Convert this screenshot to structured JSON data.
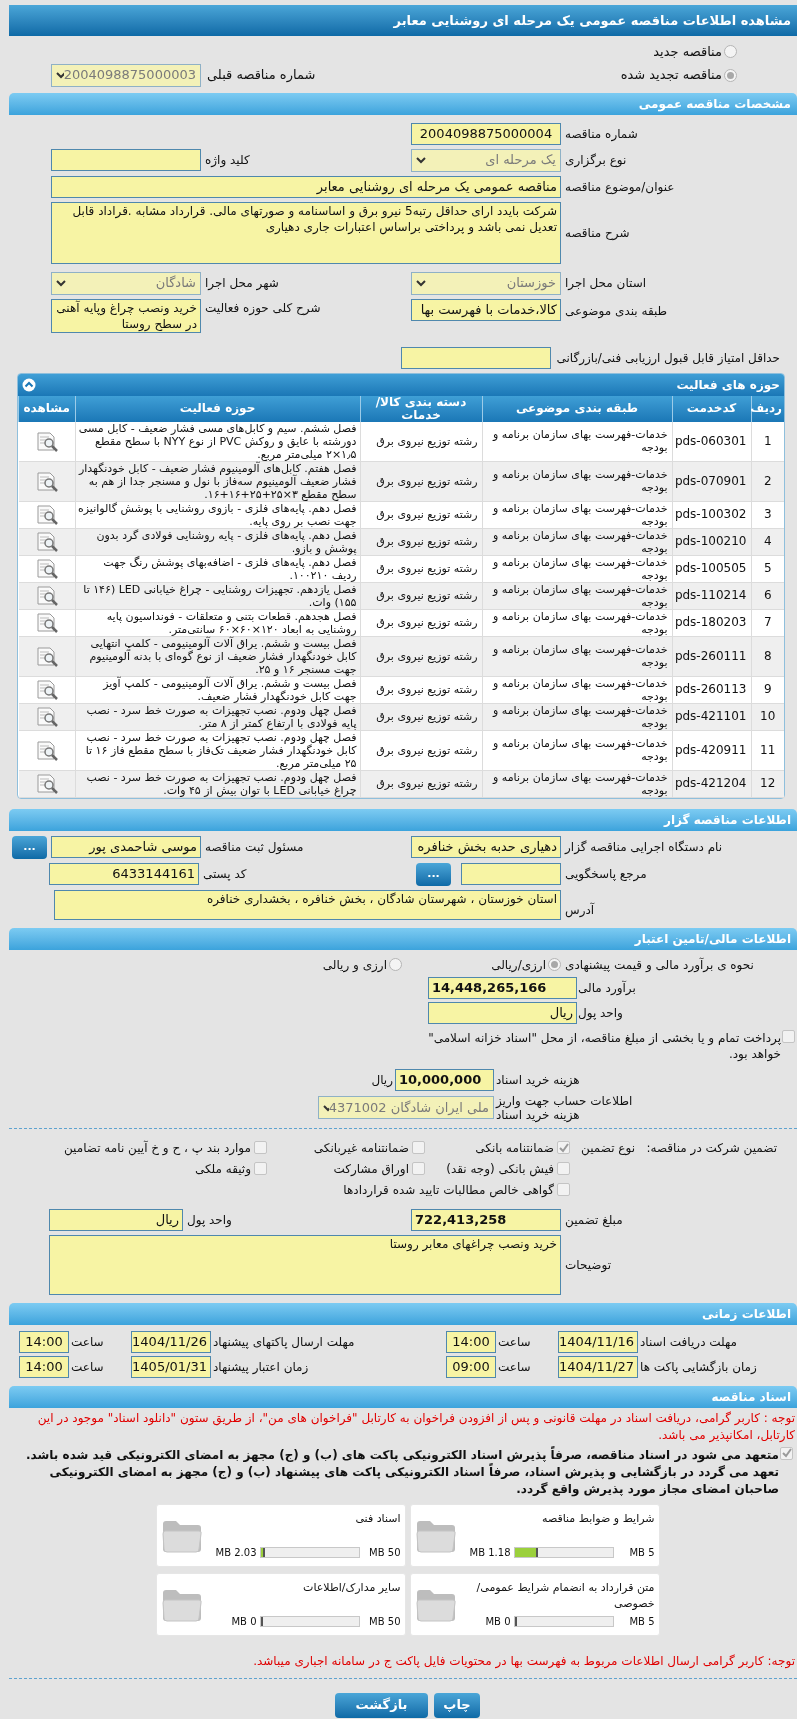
{
  "page_title": "مشاهده اطلاعات مناقصه عمومی یک مرحله ای روشنایی معابر",
  "tender_mode": [
    {
      "label": "مناقصه جدید",
      "selected": false
    },
    {
      "label": "مناقصه تجدید شده",
      "selected": true
    }
  ],
  "previous_tender": {
    "label": "شماره مناقصه قبلی",
    "value": "2004098875000003"
  },
  "general": {
    "title": "مشخصات مناقصه عمومی",
    "tender_number": {
      "label": "شماره مناقصه",
      "value": "2004098875000004"
    },
    "holding_type": {
      "label": "نوع برگزاری",
      "value": "یک مرحله ای"
    },
    "keyword": {
      "label": "کلید واژه"
    },
    "subject": {
      "label": "عنوان/موضوع مناقصه",
      "value": "مناقصه عمومی یک مرحله ای روشنایی معابر"
    },
    "description": {
      "label": "شرح مناقصه",
      "value": "شرکت بایدد ارای حداقل رتبه5 نیرو برق و اساسنامه و صورتهای مالی. قرارداد مشابه .قراداد قابل تعدیل نمی باشد و پرداختی براساس اعتبارات جاری دهیاری"
    },
    "province": {
      "label": "استان محل اجرا",
      "value": "خوزستان"
    },
    "city": {
      "label": "شهر محل اجرا",
      "value": "شادگان"
    },
    "category": {
      "label": "طبقه بندی موضوعی",
      "value": "کالا،خدمات با فهرست بها"
    },
    "activity_scope": {
      "label": "شرح کلی حوزه فعالیت",
      "value": "خرید ونصب چراغ وپایه آهنی در سطح روستا"
    },
    "min_score": {
      "label": "حداقل امتیاز قابل قبول ارزیابی فنی/بازرگانی"
    }
  },
  "activities": {
    "title": "حوزه های فعالیت",
    "columns": [
      "ردیف",
      "کدخدمت",
      "طبقه بندی موضوعی",
      "دسته بندی کالا/خدمات",
      "حوزه فعالیت",
      "مشاهده"
    ],
    "rows": [
      {
        "index": "1",
        "code": "pds-060301",
        "category": "خدمات-فهرست بهای سازمان برنامه و بودجه",
        "group": "رشته توزیع نیروی برق",
        "scope": "فصل ششم. سیم و کابل‌های مسی فشار ضعیف - کابل مسی دورشته با عایق و روکش PVC از نوع NYY با سطح مقطع ۱٫۵×۲ میلی‌متر مربع."
      },
      {
        "index": "2",
        "code": "pds-070901",
        "category": "خدمات-فهرست بهای سازمان برنامه و بودجه",
        "group": "رشته توزیع نیروی برق",
        "scope": "فصل هفتم. کابل‌های آلومینیوم فشار ضعیف - کابل خودنگهدار فشار ضعیف آلومینیوم سه‌فاز با نول و مسنجر جدا از هم به سطح مقطع ۳×۲۵+۲۵+۱۶+۱۶."
      },
      {
        "index": "3",
        "code": "pds-100302",
        "category": "خدمات-فهرست بهای سازمان برنامه و بودجه",
        "group": "رشته توزیع نیروی برق",
        "scope": "فصل دهم. پایه‌های فلزی - بازوی روشنایی با پوشش گالوانیزه جهت نصب بر روی پایه."
      },
      {
        "index": "4",
        "code": "pds-100210",
        "category": "خدمات-فهرست بهای سازمان برنامه و بودجه",
        "group": "رشته توزیع نیروی برق",
        "scope": "فصل دهم. پایه‌های فلزی - پایه روشنایی فولادی گرد بدون پوشش و بازو."
      },
      {
        "index": "5",
        "code": "pds-100505",
        "category": "خدمات-فهرست بهای سازمان برنامه و بودجه",
        "group": "رشته توزیع نیروی برق",
        "scope": "فصل دهم. پایه‌های فلزی - اضافه‌بهای پوشش رنگ جهت ردیف ۱۰۰۲۱۰."
      },
      {
        "index": "6",
        "code": "pds-110214",
        "category": "خدمات-فهرست بهای سازمان برنامه و بودجه",
        "group": "رشته توزیع نیروی برق",
        "scope": "فصل یازدهم. تجهیزات روشنایی - چراغ خیابانی LED (۱۴۶ تا ۱۵۵) وات."
      },
      {
        "index": "7",
        "code": "pds-180203",
        "category": "خدمات-فهرست بهای سازمان برنامه و بودجه",
        "group": "رشته توزیع نیروی برق",
        "scope": "فصل هجدهم. قطعات بتنی و متعلقات - فونداسیون پایه روشنایی به ابعاد ۱۲۰×۶۰×۶۰ سانتی‌متر."
      },
      {
        "index": "8",
        "code": "pds-260111",
        "category": "خدمات-فهرست بهای سازمان برنامه و بودجه",
        "group": "رشته توزیع نیروی برق",
        "scope": "فصل بیست و ششم. یراق آلات آلومینیومی - کلمپ انتهایی کابل خودنگهدار فشار ضعیف از نوع گوه‌ای با بدنه آلومینیوم جهت مسنجر ۱۶ و ۲۵."
      },
      {
        "index": "9",
        "code": "pds-260113",
        "category": "خدمات-فهرست بهای سازمان برنامه و بودجه",
        "group": "رشته توزیع نیروی برق",
        "scope": "فصل بیست و ششم. یراق آلات آلومینیومی - کلمپ آویز جهت کابل خودنگهدار فشار ضعیف."
      },
      {
        "index": "10",
        "code": "pds-421101",
        "category": "خدمات-فهرست بهای سازمان برنامه و بودجه",
        "group": "رشته توزیع نیروی برق",
        "scope": "فصل چهل ودوم. نصب تجهیزات به صورت خط سرد - نصب پایه فولادی با ارتفاع کمتر از ۸ متر."
      },
      {
        "index": "11",
        "code": "pds-420911",
        "category": "خدمات-فهرست بهای سازمان برنامه و بودجه",
        "group": "رشته توزیع نیروی برق",
        "scope": "فصل چهل ودوم. نصب تجهیزات به صورت خط سرد - نصب کابل خودنگهدار فشار ضعیف تک‌فاز با سطح مقطع فاز ۱۶ تا ۲۵ میلی‌متر مربع."
      },
      {
        "index": "12",
        "code": "pds-421204",
        "category": "خدمات-فهرست بهای سازمان برنامه و بودجه",
        "group": "رشته توزیع نیروی برق",
        "scope": "فصل چهل ودوم. نصب تجهیزات به صورت خط سرد - نصب چراغ خیابانی LED با توان بیش از ۴۵ وات."
      }
    ]
  },
  "organizer": {
    "title": "اطلاعات مناقصه گزار",
    "org_name": {
      "label": "نام دستگاه اجرایی مناقصه گزار",
      "value": "دهیاری حدبه بخش خنافره"
    },
    "registrar": {
      "label": "مسئول ثبت مناقصه",
      "value": "موسی شاحمدی پور",
      "button": "..."
    },
    "reference": {
      "label": "مرجع پاسخگویی",
      "button": "..."
    },
    "postal_code": {
      "label": "کد پستی",
      "value": "6433144161"
    },
    "address": {
      "label": "آدرس",
      "value": "استان خوزستان ، شهرستان شادگان ، بخش خنافره ، بخشداری خنافره"
    }
  },
  "financial": {
    "title": "اطلاعات مالی/تامین اعتبار",
    "estimate_method": {
      "label": "نحوه ی برآورد مالی و قیمت پیشنهادی",
      "options": [
        {
          "label": "ارزی/ریالی",
          "selected": true
        },
        {
          "label": "ارزی و ریالی",
          "selected": false
        }
      ]
    },
    "estimate": {
      "label": "برآورد مالی",
      "value": "14,448,265,166"
    },
    "currency": {
      "label": "واحد پول",
      "value": "ریال"
    },
    "treasury": {
      "label": "پرداخت تمام و یا بخشی از مبلغ مناقصه، از محل \"اسناد خزانه اسلامی\" خواهد بود.",
      "checked": false
    },
    "doc_fee": {
      "label": "هزینه خرید اسناد",
      "value": "10,000,000",
      "unit": "ریال"
    },
    "account": {
      "label": "اطلاعات حساب جهت واریز هزینه خرید اسناد",
      "value": "ملی ایران شادگان 4371002"
    }
  },
  "guarantee": {
    "title": "تضمین شرکت در مناقصه:",
    "type_label": "نوع تضمین",
    "options": [
      {
        "label": "ضمانتنامه بانکی",
        "checked": true
      },
      {
        "label": "ضمانتنامه غیربانکی",
        "checked": false
      },
      {
        "label": "موارد بند پ ، ح و خ آیین نامه تضامین",
        "checked": false
      },
      {
        "label": "فیش بانکی (وجه نقد)",
        "checked": false
      },
      {
        "label": "اوراق مشارکت",
        "checked": false
      },
      {
        "label": "وثیقه ملکی",
        "checked": false
      },
      {
        "label": "گواهی خالص مطالبات تایید شده قراردادها",
        "checked": false
      }
    ],
    "amount": {
      "label": "مبلغ تضمین",
      "value": "722,413,258"
    },
    "currency": {
      "label": "واحد پول",
      "value": "ریال"
    },
    "notes": {
      "label": "توضیحات",
      "value": "خرید ونصب چراغهای معابر روستا"
    }
  },
  "timing": {
    "title": "اطلاعات زمانی",
    "items": [
      {
        "label": "مهلت دریافت اسناد",
        "date": "1404/11/16",
        "time_label": "ساعت",
        "time": "14:00"
      },
      {
        "label": "مهلت ارسال پاکتهای پیشنهاد",
        "date": "1404/11/26",
        "time_label": "ساعت",
        "time": "14:00"
      },
      {
        "label": "زمان بازگشایی پاکت ها",
        "date": "1404/11/27",
        "time_label": "ساعت",
        "time": "09:00"
      },
      {
        "label": "زمان اعتبار پیشنهاد",
        "date": "1405/01/31",
        "time_label": "ساعت",
        "time": "14:00"
      }
    ]
  },
  "documents": {
    "title": "اسناد مناقصه",
    "notice": "توجه : کاربر گرامی، دریافت اسناد در مهلت قانونی و پس از افزودن فراخوان به کارتابل \"فراخوان های من\"، از طریق ستون \"دانلود اسناد\" موجود در این کارتابل، امکانپذیر می باشد.",
    "commitment": {
      "text": "متعهد می شود در اسناد مناقصه، صرفاً پذیرش اسناد الکترونیکی پاکت های (ب) و (ج) مجهز به امضای الکترونیکی قید شده باشد. تعهد می گردد در بازگشایی و پذیرش اسناد، صرفاً اسناد الکترونیکی پاکت های پیشنهاد (ب) و (ج) مجهز به امضای الکترونیکی صاحبان امضای مجاز مورد پذیرش واقع گردد.",
      "checked": true
    },
    "files": [
      {
        "name": "شرایط و ضوابط مناقصه",
        "max": "5 MB",
        "used": "1.18 MB",
        "level": 0.236
      },
      {
        "name": "اسناد فنی",
        "max": "50 MB",
        "used": "2.03 MB",
        "level": 0.041
      },
      {
        "name": "متن قرارداد به انضمام شرایط عمومی/خصوصی",
        "max": "5 MB",
        "used": "0 MB",
        "level": 0
      },
      {
        "name": "سایر مدارک/اطلاعات",
        "max": "50 MB",
        "used": "0 MB",
        "level": 0
      }
    ],
    "footer_notice": "توجه: کاربر گرامی ارسال اطلاعات مربوط به فهرست بها در محتویات فایل پاکت ج در سامانه اجباری میباشد."
  },
  "buttons": [
    "چاپ",
    "بازگشت"
  ]
}
